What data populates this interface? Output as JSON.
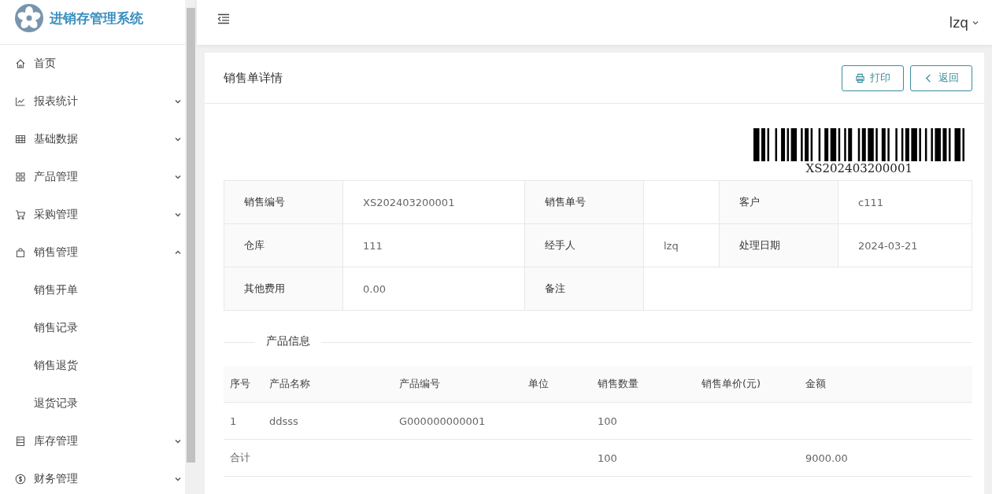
{
  "app": {
    "title": "进销存管理系统"
  },
  "sidebar": {
    "items": [
      {
        "label": "首页",
        "kind": "link"
      },
      {
        "label": "报表统计",
        "kind": "group",
        "expanded": false
      },
      {
        "label": "基础数据",
        "kind": "group",
        "expanded": false
      },
      {
        "label": "产品管理",
        "kind": "group",
        "expanded": false
      },
      {
        "label": "采购管理",
        "kind": "group",
        "expanded": false
      },
      {
        "label": "销售管理",
        "kind": "group",
        "expanded": true,
        "children": [
          {
            "label": "销售开单"
          },
          {
            "label": "销售记录"
          },
          {
            "label": "销售退货"
          },
          {
            "label": "退货记录"
          }
        ]
      },
      {
        "label": "库存管理",
        "kind": "group",
        "expanded": false
      },
      {
        "label": "财务管理",
        "kind": "group",
        "expanded": false
      }
    ]
  },
  "header": {
    "user": "lzq"
  },
  "card": {
    "title": "销售单详情",
    "buttons": [
      {
        "label": "打印",
        "kind": "print"
      },
      {
        "label": "返回",
        "kind": "back"
      }
    ],
    "barcode": {
      "text": "XS202403200001"
    },
    "info_rows": [
      [
        {
          "label": "销售编号",
          "value": "XS202403200001"
        },
        {
          "label": "销售单号"
        },
        {
          "label": "客户",
          "value": "c111"
        }
      ],
      [
        {
          "label": "仓库",
          "value": "111"
        },
        {
          "label": "经手人",
          "value": "lzq"
        },
        {
          "label": "处理日期",
          "value": "2024-03-21"
        }
      ],
      [
        {
          "label": "其他费用",
          "value": "0.00"
        },
        {
          "label": "备注"
        }
      ]
    ],
    "section_title": "产品信息",
    "table": {
      "columns": [
        "序号",
        "产品名称",
        "产品编号",
        "单位",
        "销售数量",
        "销售单价(元)",
        "金额"
      ],
      "rows": [
        {
          "cells": [
            "1",
            "ddsss",
            "G000000000001",
            null,
            "100",
            null,
            null
          ]
        }
      ],
      "total": {
        "cells": [
          "合计",
          null,
          null,
          null,
          "100",
          null,
          "9000.00"
        ]
      }
    }
  }
}
